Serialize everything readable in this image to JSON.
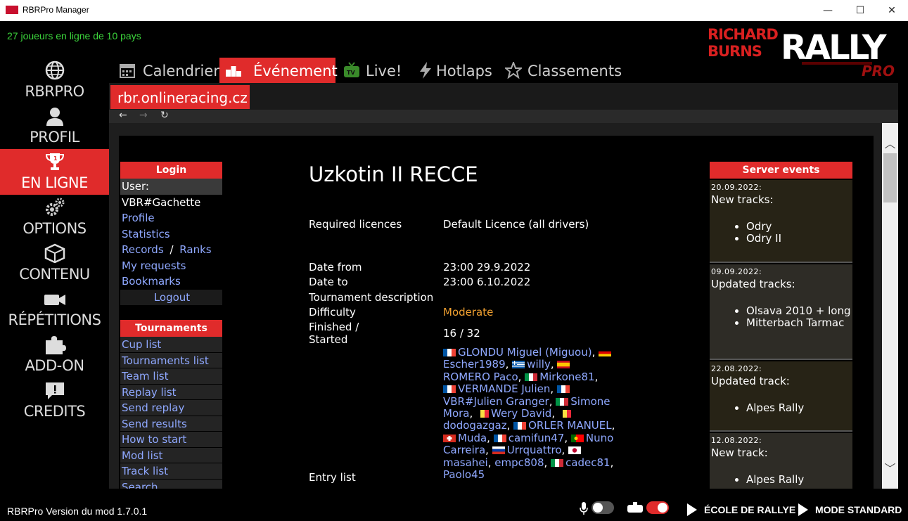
{
  "window": {
    "title": "RBRPro Manager",
    "minimize": "—",
    "maximize": "☐",
    "close": "✕"
  },
  "status": {
    "online": "27 joueurs en ligne de 10 pays"
  },
  "logo": {
    "line1": "RICHARD",
    "line2": "BURNS",
    "rally": "RALLY",
    "pro": "PRO"
  },
  "leftnav": [
    {
      "label": "RBRPRO",
      "icon": "globe-icon"
    },
    {
      "label": "PROFIL",
      "icon": "user-icon"
    },
    {
      "label": "EN LIGNE",
      "icon": "trophy-icon",
      "active": true
    },
    {
      "label": "OPTIONS",
      "icon": "gears-icon"
    },
    {
      "label": "CONTENU",
      "icon": "box-icon"
    },
    {
      "label": "RÉPÉTITIONS",
      "icon": "camera-icon"
    },
    {
      "label": "ADD-ON",
      "icon": "puzzle-icon"
    },
    {
      "label": "CREDITS",
      "icon": "chat-icon"
    }
  ],
  "tabs": [
    {
      "label": "Calendrier",
      "icon": "calendar-icon"
    },
    {
      "label": "Événement",
      "icon": "podium-icon",
      "active": true
    },
    {
      "label": "Live!",
      "icon": "tv-icon"
    },
    {
      "label": "Hotlaps",
      "icon": "bolt-icon"
    },
    {
      "label": "Classements",
      "icon": "star-icon"
    }
  ],
  "site": {
    "tab": "rbr.onlineracing.cz",
    "back": "←",
    "forward": "→",
    "reload": "↻"
  },
  "login": {
    "header": "Login",
    "user_label": "User:",
    "username": "VBR#Gachette",
    "profile": "Profile",
    "statistics": "Statistics",
    "records": "Records",
    "slash": "/",
    "ranks": "Ranks",
    "my_requests": "My requests",
    "bookmarks": "Bookmarks",
    "logout": "Logout"
  },
  "tournaments": {
    "header": "Tournaments",
    "items": [
      "Cup list",
      "Tournaments list",
      "Team list",
      "Replay list",
      "Send replay",
      "Send results",
      "How to start",
      "Mod list",
      "Track list",
      "Search"
    ]
  },
  "event": {
    "title": "Uzkotin II RECCE",
    "required_licences_label": "Required licences",
    "required_licences": "Default Licence (all drivers)",
    "date_from_label": "Date from",
    "date_from": "23:00 29.9.2022",
    "date_to_label": "Date to",
    "date_to": "23:00 6.10.2022",
    "description_label": "Tournament description",
    "difficulty_label": "Difficulty",
    "difficulty": "Moderate",
    "finished_label_1": "Finished /",
    "finished_label_2": "Started",
    "finished": "16 / 32",
    "entry_list_label": "Entry list"
  },
  "entries": [
    {
      "flag": "fr",
      "name": "GLONDU Miguel (Miguou)"
    },
    {
      "flag": "de",
      "name": "Escher1989"
    },
    {
      "flag": "gr",
      "name": "willy"
    },
    {
      "flag": "es",
      "name": "ROMERO Paco"
    },
    {
      "flag": "it",
      "name": "Mirkone81"
    },
    {
      "flag": "fr",
      "name": "VERMANDE Julien"
    },
    {
      "flag": "fr",
      "name": "VBR#Julien Granger"
    },
    {
      "flag": "it",
      "name": "Simone Mora"
    },
    {
      "flag": "be",
      "name": "Wery David"
    },
    {
      "flag": "be",
      "name": "dodogazgaz"
    },
    {
      "flag": "fr",
      "name": "ORLER MANUEL"
    },
    {
      "flag": "ch",
      "name": "Muda"
    },
    {
      "flag": "fr",
      "name": "camifun47"
    },
    {
      "flag": "pt",
      "name": "Nuno Carreira"
    },
    {
      "flag": "ru",
      "name": "Urrquattro"
    },
    {
      "flag": "jp",
      "name": "masahei"
    },
    {
      "flag": "none",
      "name": "empc808"
    },
    {
      "flag": "it",
      "name": "cadec81"
    },
    {
      "flag": "none",
      "name": "Paolo45"
    }
  ],
  "server_events": {
    "header": "Server events",
    "items": [
      {
        "date": "20.09.2022:",
        "kind": "New tracks:",
        "tracks": [
          "Odry",
          "Odry II"
        ]
      },
      {
        "date": "09.09.2022:",
        "kind": "Updated tracks:",
        "tracks": [
          "Olsava 2010 + long",
          "Mitterbach Tarmac"
        ]
      },
      {
        "date": "22.08.2022:",
        "kind": "Updated track:",
        "tracks": [
          "Alpes Rally"
        ]
      },
      {
        "date": "12.08.2022:",
        "kind": "New track:",
        "tracks": [
          "Alpes Rally"
        ]
      }
    ]
  },
  "footer": {
    "version": "RBRPro Version du mod 1.7.0.1",
    "ecole": "ÉCOLE DE RALLYE",
    "mode": "MODE STANDARD"
  },
  "colors": {
    "accent": "#e02b2b",
    "link": "#8fa8ff",
    "online": "#3cd63c",
    "difficulty": "#f0a030"
  }
}
